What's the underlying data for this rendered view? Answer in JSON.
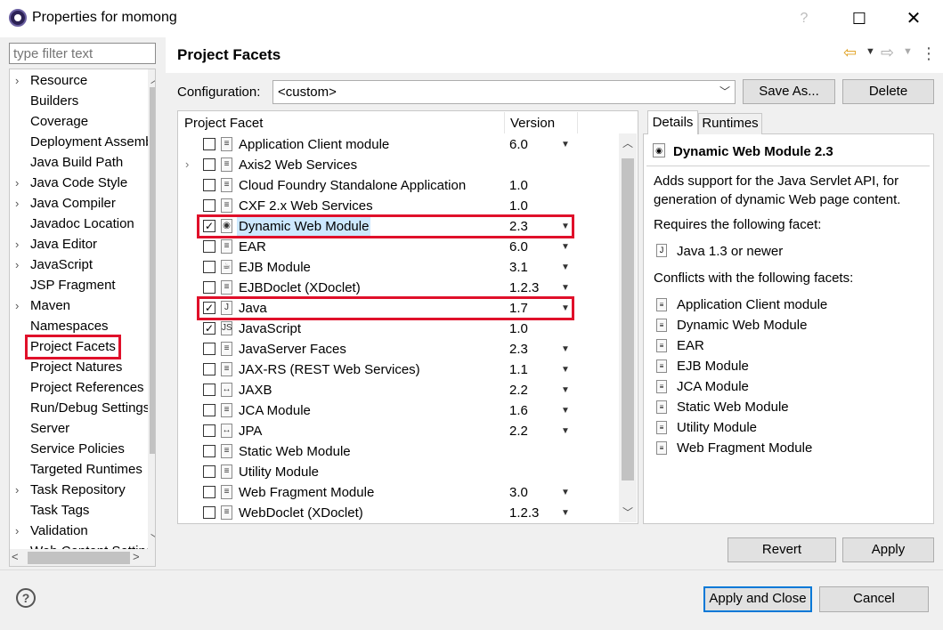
{
  "window": {
    "title": "Properties for momong",
    "help_glyph": "?",
    "maximize_glyph": "☐",
    "close_glyph": "✕"
  },
  "filter": {
    "placeholder": "type filter text"
  },
  "tree": {
    "items": [
      {
        "label": "Resource",
        "expandable": true
      },
      {
        "label": "Builders",
        "expandable": false
      },
      {
        "label": "Coverage",
        "expandable": false
      },
      {
        "label": "Deployment Assembly",
        "expandable": false
      },
      {
        "label": "Java Build Path",
        "expandable": false
      },
      {
        "label": "Java Code Style",
        "expandable": true
      },
      {
        "label": "Java Compiler",
        "expandable": true
      },
      {
        "label": "Javadoc Location",
        "expandable": false
      },
      {
        "label": "Java Editor",
        "expandable": true
      },
      {
        "label": "JavaScript",
        "expandable": true
      },
      {
        "label": "JSP Fragment",
        "expandable": false
      },
      {
        "label": "Maven",
        "expandable": true
      },
      {
        "label": "Namespaces",
        "expandable": false
      },
      {
        "label": "Project Facets",
        "expandable": false,
        "selected": true
      },
      {
        "label": "Project Natures",
        "expandable": false
      },
      {
        "label": "Project References",
        "expandable": false
      },
      {
        "label": "Run/Debug Settings",
        "expandable": false
      },
      {
        "label": "Server",
        "expandable": false
      },
      {
        "label": "Service Policies",
        "expandable": false
      },
      {
        "label": "Targeted Runtimes",
        "expandable": false
      },
      {
        "label": "Task Repository",
        "expandable": true
      },
      {
        "label": "Task Tags",
        "expandable": false
      },
      {
        "label": "Validation",
        "expandable": true
      },
      {
        "label": "Web Content Settings",
        "expandable": false
      }
    ]
  },
  "header": {
    "title": "Project Facets"
  },
  "configuration": {
    "label": "Configuration:",
    "value": "<custom>",
    "save_as": "Save As...",
    "delete": "Delete"
  },
  "facets": {
    "col_facet": "Project Facet",
    "col_version": "Version",
    "rows": [
      {
        "label": "Application Client module",
        "version": "6.0",
        "checked": false,
        "dropdown": true,
        "expand": false,
        "icon": "doc"
      },
      {
        "label": "Axis2 Web Services",
        "version": "",
        "checked": false,
        "dropdown": false,
        "expand": true,
        "icon": "doc"
      },
      {
        "label": "Cloud Foundry Standalone Application",
        "version": "1.0",
        "checked": false,
        "dropdown": false,
        "expand": false,
        "icon": "doc"
      },
      {
        "label": "CXF 2.x Web Services",
        "version": "1.0",
        "checked": false,
        "dropdown": false,
        "expand": false,
        "icon": "doc"
      },
      {
        "label": "Dynamic Web Module",
        "version": "2.3",
        "checked": true,
        "dropdown": true,
        "expand": false,
        "icon": "globe",
        "selected": true
      },
      {
        "label": "EAR",
        "version": "6.0",
        "checked": false,
        "dropdown": true,
        "expand": false,
        "icon": "doc"
      },
      {
        "label": "EJB Module",
        "version": "3.1",
        "checked": false,
        "dropdown": true,
        "expand": false,
        "icon": "bean"
      },
      {
        "label": "EJBDoclet (XDoclet)",
        "version": "1.2.3",
        "checked": false,
        "dropdown": true,
        "expand": false,
        "icon": "doc"
      },
      {
        "label": "Java",
        "version": "1.7",
        "checked": true,
        "dropdown": true,
        "expand": false,
        "icon": "java"
      },
      {
        "label": "JavaScript",
        "version": "1.0",
        "checked": true,
        "dropdown": false,
        "expand": false,
        "icon": "lock"
      },
      {
        "label": "JavaServer Faces",
        "version": "2.3",
        "checked": false,
        "dropdown": true,
        "expand": false,
        "icon": "doc"
      },
      {
        "label": "JAX-RS (REST Web Services)",
        "version": "1.1",
        "checked": false,
        "dropdown": true,
        "expand": false,
        "icon": "doc"
      },
      {
        "label": "JAXB",
        "version": "2.2",
        "checked": false,
        "dropdown": true,
        "expand": false,
        "icon": "arrows"
      },
      {
        "label": "JCA Module",
        "version": "1.6",
        "checked": false,
        "dropdown": true,
        "expand": false,
        "icon": "doc"
      },
      {
        "label": "JPA",
        "version": "2.2",
        "checked": false,
        "dropdown": true,
        "expand": false,
        "icon": "arrows"
      },
      {
        "label": "Static Web Module",
        "version": "",
        "checked": false,
        "dropdown": false,
        "expand": false,
        "icon": "doc"
      },
      {
        "label": "Utility Module",
        "version": "",
        "checked": false,
        "dropdown": false,
        "expand": false,
        "icon": "doc"
      },
      {
        "label": "Web Fragment Module",
        "version": "3.0",
        "checked": false,
        "dropdown": true,
        "expand": false,
        "icon": "doc"
      },
      {
        "label": "WebDoclet (XDoclet)",
        "version": "1.2.3",
        "checked": false,
        "dropdown": true,
        "expand": false,
        "icon": "doc"
      }
    ]
  },
  "details": {
    "tab_details": "Details",
    "tab_runtimes": "Runtimes",
    "title": "Dynamic Web Module 2.3",
    "description": "Adds support for the Java Servlet API, for generation of dynamic Web page content.",
    "requires_label": "Requires the following facet:",
    "requires_item": "Java 1.3 or newer",
    "conflicts_label": "Conflicts with the following facets:",
    "conflicts": [
      "Application Client module",
      "Dynamic Web Module",
      "EAR",
      "EJB Module",
      "JCA Module",
      "Static Web Module",
      "Utility Module",
      "Web Fragment Module"
    ]
  },
  "buttons": {
    "revert": "Revert",
    "apply": "Apply",
    "apply_close": "Apply and Close",
    "cancel": "Cancel",
    "help": "?"
  },
  "colors": {
    "highlight_box": "#e0102a",
    "selection": "#cce8ff",
    "default_button_border": "#0078d7"
  }
}
